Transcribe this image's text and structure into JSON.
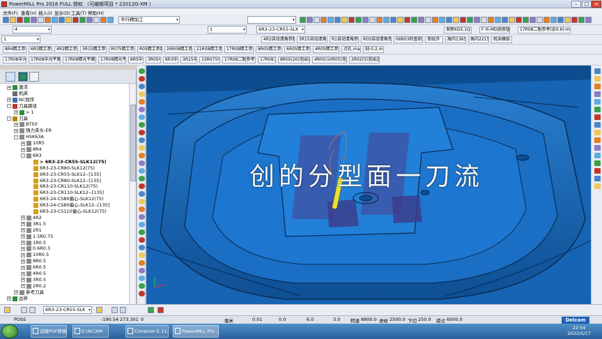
{
  "window": {
    "title": "PowerMILL Pro 2016 FULL 授权  （可编辑项目 * 22012G-XM ）"
  },
  "menu": [
    "文件(F)",
    "查看(V)",
    "插入(I)",
    "显示(D)",
    "工具(T)",
    "帮助(H)"
  ],
  "toolbar1": {
    "strategy_combo": "平行精加工",
    "other_combo": ""
  },
  "toolbar2": {
    "left_combo": "4",
    "count_combo": "1",
    "tool_combo": "6R3-23-CR55-SLK",
    "prog_button": "发新KGS.1Q1",
    "mid_button": "F 0i-MD放按钮",
    "right_button": "17R08二粗参考(余0.6)-mulk"
  },
  "toolbar3": {
    "combo": "1",
    "buttons": [
      "4R2自动清角参数",
      "3R15自动清角参数",
      "R1自动清角参数",
      "R05自动清角参数",
      "06R03检查研磨",
      "单线浮",
      "高内1365",
      "高内2215",
      "机床模拟"
    ]
  },
  "toolbar4": {
    "buttons": [
      "8R4精工参数",
      "6R3精工参数",
      "4R2精工参数",
      "3R15精工参数",
      "R075精工参数",
      "R05精工参数",
      "26R08精工参数",
      "21R08精工参数",
      "17R08精工参数",
      "8R05精工参数",
      "6R05精工参数",
      "4R05精工参数",
      "点孔.mac",
      "刻-0.2.mac"
    ]
  },
  "toolbar5": {
    "buttons": [
      "17R08中光平面",
      "17R08中光平面（面积）",
      "17R08精光平面（1）",
      "17R08精光平面",
      "6R5中圆",
      "3R05中圆",
      "6R3中圆",
      "3R15中圆",
      "15R075中圆",
      "17R08二粗参考(余0.6)",
      "17R08二粗",
      "8R05(20)泡梁边界",
      "4R05(10R05)泡梁边界",
      "2R02(5)泡梁边界"
    ]
  },
  "tree": [
    {
      "label": "激活",
      "level": 0,
      "expander": "+",
      "color": "#2e8b3a"
    },
    {
      "label": "机床",
      "level": 0,
      "expander": "",
      "color": "#6b6b6b"
    },
    {
      "label": "NC程序",
      "level": 0,
      "expander": "+",
      "color": "#3b6fb6"
    },
    {
      "label": "刀具路径",
      "level": 0,
      "expander": "-",
      "color": "#c0392b"
    },
    {
      "label": "> 1",
      "level": 1,
      "expander": "+",
      "color": "#2e8b3a"
    },
    {
      "label": "刀具",
      "level": 0,
      "expander": "-",
      "color": "#b8860b"
    },
    {
      "label": "BT50",
      "level": 1,
      "expander": "+",
      "color": "#8a8a8a"
    },
    {
      "label": "强力夹头-ER",
      "level": 1,
      "expander": "+",
      "color": "#8a8a8a"
    },
    {
      "label": "HSK63A",
      "level": 1,
      "expander": "-",
      "color": "#8a8a8a"
    },
    {
      "label": "10R5",
      "level": 2,
      "expander": "+",
      "color": "#8a8a8a"
    },
    {
      "label": "8R4",
      "level": 2,
      "expander": "+",
      "color": "#8a8a8a"
    },
    {
      "label": "6R3",
      "level": 2,
      "expander": "-",
      "color": "#8a8a8a"
    },
    {
      "label": "> 6R3-23-CR55-SLK12(75)",
      "level": 3,
      "expander": "",
      "color": "#d4a017",
      "selected": true
    },
    {
      "label": "6R3-23-CR80-SLK12(75)",
      "level": 3,
      "expander": "",
      "color": "#d4a017"
    },
    {
      "label": "6R3-23-CR55-SLK12--[135]",
      "level": 3,
      "expander": "",
      "color": "#d4a017"
    },
    {
      "label": "6R3-23-CR80-SLK12--[135]",
      "level": 3,
      "expander": "",
      "color": "#d4a017"
    },
    {
      "label": "6R3-23-CR110-SLK12(75)",
      "level": 3,
      "expander": "",
      "color": "#d4a017"
    },
    {
      "label": "6R3-23-CR110-SLK12--[135]",
      "level": 3,
      "expander": "",
      "color": "#d4a017"
    },
    {
      "label": "6R3-24-CS80偏心-SLK12(75)",
      "level": 3,
      "expander": "",
      "color": "#d4a017"
    },
    {
      "label": "6R3-24-CS80偏心-SLK12--[135]",
      "level": 3,
      "expander": "",
      "color": "#d4a017"
    },
    {
      "label": "6R3-23-CS110偏心-SLK12(75)",
      "level": 3,
      "expander": "",
      "color": "#d4a017"
    },
    {
      "label": "4R2",
      "level": 2,
      "expander": "+",
      "color": "#8a8a8a"
    },
    {
      "label": "3R1.5",
      "level": 2,
      "expander": "+",
      "color": "#8a8a8a"
    },
    {
      "label": "2R1",
      "level": 2,
      "expander": "+",
      "color": "#8a8a8a"
    },
    {
      "label": "1.5R0.75",
      "level": 2,
      "expander": "+",
      "color": "#8a8a8a"
    },
    {
      "label": "1R0.5",
      "level": 2,
      "expander": "+",
      "color": "#8a8a8a"
    },
    {
      "label": "0.6R0.3",
      "level": 2,
      "expander": "+",
      "color": "#8a8a8a"
    },
    {
      "label": "10R0.5",
      "level": 2,
      "expander": "+",
      "color": "#8a8a8a"
    },
    {
      "label": "8R0.5",
      "level": 2,
      "expander": "+",
      "color": "#8a8a8a"
    },
    {
      "label": "6R0.5",
      "level": 2,
      "expander": "+",
      "color": "#8a8a8a"
    },
    {
      "label": "4R0.5",
      "level": 2,
      "expander": "+",
      "color": "#8a8a8a"
    },
    {
      "label": "3R0.5",
      "level": 2,
      "expander": "+",
      "color": "#8a8a8a"
    },
    {
      "label": "2R0.2",
      "level": 2,
      "expander": "+",
      "color": "#8a8a8a"
    },
    {
      "label": "参考刀具",
      "level": 1,
      "expander": "+",
      "color": "#8a8a8a"
    },
    {
      "label": "边界",
      "level": 0,
      "expander": "+",
      "color": "#2e8b3a"
    }
  ],
  "viewport": {
    "caption": "创的分型面一刀流",
    "background_color": "#0d4d8f",
    "surface_color": "#1b6fc0"
  },
  "bottombar": {
    "tool_combo": "6R3-23-CR55-SLK"
  },
  "status": {
    "mode": "POSS",
    "x": "-190.54",
    "y": "273.301",
    "z": "0",
    "unit": "毫米",
    "tolerance": "0.01",
    "thickness": "0.0",
    "stepover": "6.0",
    "stepdown": "3.0",
    "speed_label": "转速",
    "speed": "8800.0",
    "feed_label": "进给",
    "feed": "2500.0",
    "plunge_label": "下切",
    "plunge": "250.0",
    "skim_label": "掠过",
    "skim": "6000.0",
    "brand": "Delcam"
  },
  "taskbar": {
    "tasks": [
      "迅捷PDF转换器",
      "E:\\NC\\XM",
      "Cimatron E 11.0...",
      "PowerMILL Pro ..."
    ],
    "time": "22:54",
    "date": "2022/5/17"
  }
}
